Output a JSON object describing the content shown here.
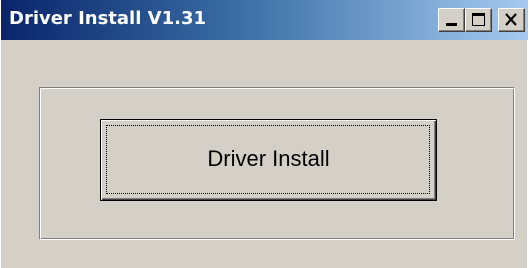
{
  "window": {
    "title": "Driver Install V1.31"
  },
  "caption_buttons": {
    "minimize_icon": "minimize-icon",
    "maximize_icon": "maximize-icon",
    "close_icon": "close-icon"
  },
  "main": {
    "install_button_label": "Driver Install"
  },
  "colors": {
    "titlebar_start": "#0a246a",
    "titlebar_end": "#a6caf0",
    "window_face": "#d4d0c8",
    "title_text": "#ffffff"
  }
}
